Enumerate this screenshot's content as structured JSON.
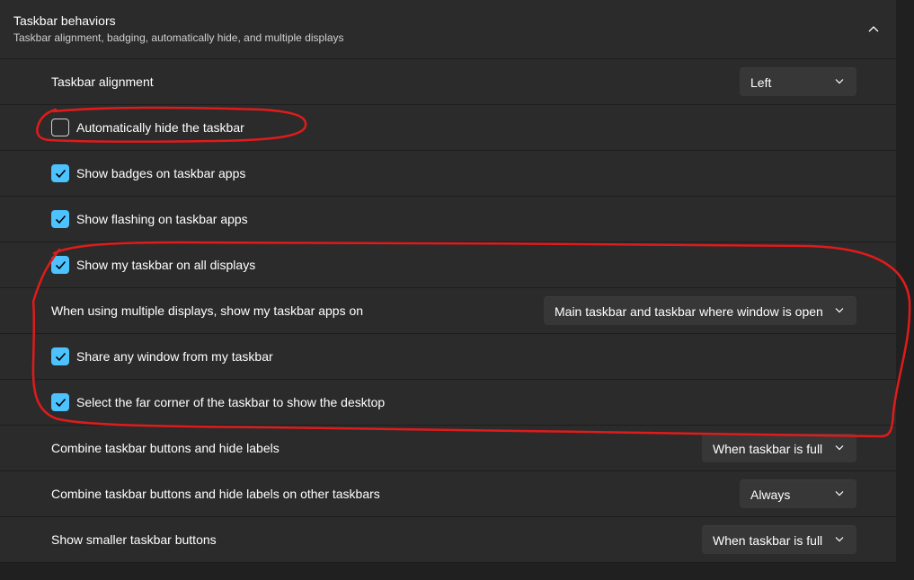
{
  "section": {
    "title": "Taskbar behaviors",
    "subtitle": "Taskbar alignment, badging, automatically hide, and multiple displays",
    "collapse_icon": "chevron-up-icon"
  },
  "settings": {
    "alignment": {
      "label": "Taskbar alignment",
      "value": "Left"
    },
    "auto_hide": {
      "label": "Automatically hide the taskbar",
      "checked": false
    },
    "badges": {
      "label": "Show badges on taskbar apps",
      "checked": true
    },
    "flashing": {
      "label": "Show flashing on taskbar apps",
      "checked": true
    },
    "all_displays": {
      "label": "Show my taskbar on all displays",
      "checked": true
    },
    "multi_display_apps": {
      "label": "When using multiple displays, show my taskbar apps on",
      "value": "Main taskbar and taskbar where window is open"
    },
    "share_window": {
      "label": "Share any window from my taskbar",
      "checked": true
    },
    "far_corner": {
      "label": "Select the far corner of the taskbar to show the desktop",
      "checked": true
    },
    "combine": {
      "label": "Combine taskbar buttons and hide labels",
      "value": "When taskbar is full"
    },
    "combine_other": {
      "label": "Combine taskbar buttons and hide labels on other taskbars",
      "value": "Always"
    },
    "smaller_buttons": {
      "label": "Show smaller taskbar buttons",
      "value": "When taskbar is full"
    }
  },
  "colors": {
    "accent": "#4cc2ff",
    "annotation": "#e01b1b",
    "row_background": "#2b2b2b",
    "dropdown_background": "#373737"
  }
}
